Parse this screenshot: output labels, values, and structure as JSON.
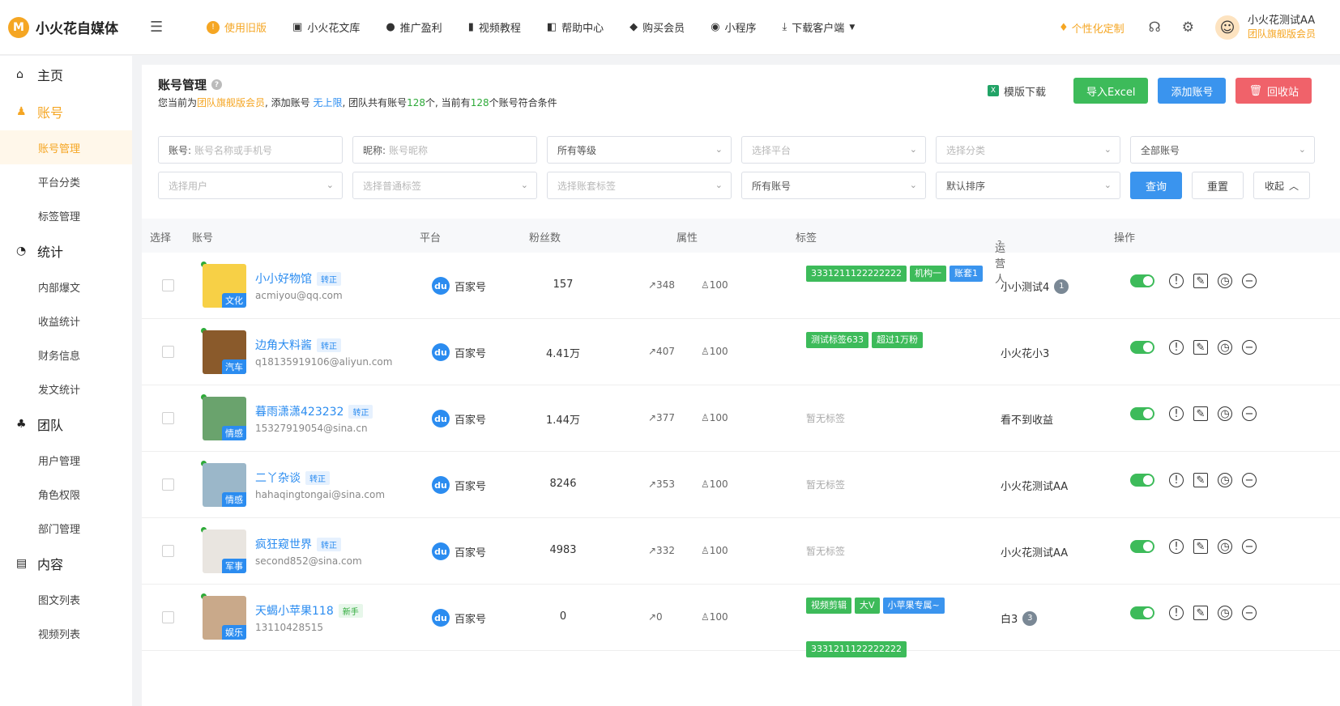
{
  "app": {
    "logo_letter": "M",
    "title": "小火花自媒体"
  },
  "nav": {
    "items": [
      {
        "label": "使用旧版",
        "icon": "info-icon",
        "active": true
      },
      {
        "label": "小火花文库",
        "icon": "library-icon"
      },
      {
        "label": "推广盈利",
        "icon": "moneybag-icon"
      },
      {
        "label": "视频教程",
        "icon": "video-icon"
      },
      {
        "label": "帮助中心",
        "icon": "book-icon"
      },
      {
        "label": "购买会员",
        "icon": "diamond-icon"
      },
      {
        "label": "小程序",
        "icon": "miniprogram-icon"
      },
      {
        "label": "下载客户端",
        "icon": "download-icon"
      }
    ],
    "custom": "个性化定制",
    "user": {
      "name": "小火花测试AA",
      "role": "团队旗舰版会员"
    }
  },
  "sidebar": {
    "groups": [
      {
        "label": "主页",
        "icon": "home-icon"
      },
      {
        "label": "账号",
        "icon": "user-icon",
        "active": true,
        "items": [
          {
            "label": "账号管理",
            "active": true
          },
          {
            "label": "平台分类"
          },
          {
            "label": "标签管理"
          }
        ]
      },
      {
        "label": "统计",
        "icon": "pie-icon",
        "items": [
          {
            "label": "内部爆文"
          },
          {
            "label": "收益统计"
          },
          {
            "label": "财务信息"
          },
          {
            "label": "发文统计"
          }
        ]
      },
      {
        "label": "团队",
        "icon": "team-icon",
        "items": [
          {
            "label": "用户管理"
          },
          {
            "label": "角色权限"
          },
          {
            "label": "部门管理"
          }
        ]
      },
      {
        "label": "内容",
        "icon": "doc-icon",
        "items": [
          {
            "label": "图文列表"
          },
          {
            "label": "视频列表"
          }
        ]
      }
    ]
  },
  "page": {
    "title": "账号管理",
    "sub_prefix": "您当前为",
    "sub_member": "团队旗舰版会员",
    "sub_mid": ", 添加账号 ",
    "sub_unlimited": "无上限",
    "sub_team": ", 团队共有账号",
    "sub_total": "128",
    "sub_unit": "个, 当前有",
    "sub_match": "128",
    "sub_end": "个账号符合条件",
    "template_download": "模版下载",
    "import_excel": "导入Excel",
    "add_account": "添加账号",
    "recycle": "回收站"
  },
  "filters": {
    "account_label": "账号:",
    "account_placeholder": "账号名称或手机号",
    "nickname_label": "昵称:",
    "nickname_placeholder": "账号昵称",
    "level": "所有等级",
    "platform": "选择平台",
    "category": "选择分类",
    "all_accounts": "全部账号",
    "user": "选择用户",
    "common_tag": "选择普通标签",
    "private_tag": "选择账套标签",
    "all_acc2": "所有账号",
    "sort": "默认排序",
    "query": "查询",
    "reset": "重置",
    "collapse": "收起"
  },
  "table": {
    "headers": {
      "select": "选择",
      "account": "账号",
      "platform": "平台",
      "fans": "粉丝数",
      "attr": "属性",
      "tags": "标签",
      "operator": "运营人",
      "ops": "操作"
    },
    "rows": [
      {
        "name": "小小好物馆",
        "badge": "转正",
        "email": "acmiyou@qq.com",
        "cat": "文化",
        "platform": "百家号",
        "fans": "157",
        "a1": "↗348",
        "a2": "♙100",
        "tags": [
          {
            "t": "3331211122222222",
            "c": "g"
          },
          {
            "t": "机构一",
            "c": "g"
          },
          {
            "t": "账套1",
            "c": "b"
          }
        ],
        "operator": "小小测试4",
        "opnum": "1",
        "avbg": "#f7d046"
      },
      {
        "name": "边角大料酱",
        "badge": "转正",
        "email": "q18135919106@aliyun.com",
        "cat": "汽车",
        "platform": "百家号",
        "fans": "4.41万",
        "a1": "↗407",
        "a2": "♙100",
        "tags": [
          {
            "t": "测试标签633",
            "c": "g"
          },
          {
            "t": "超过1万粉",
            "c": "g"
          }
        ],
        "operator": "小火花小3",
        "opnum": "",
        "avbg": "#8a5a2b"
      },
      {
        "name": "暮雨潇潇423232",
        "badge": "转正",
        "email": "15327919054@sina.cn",
        "cat": "情感",
        "platform": "百家号",
        "fans": "1.44万",
        "a1": "↗377",
        "a2": "♙100",
        "tags": [],
        "notag": "暂无标签",
        "operator": "看不到收益",
        "opnum": "",
        "avbg": "#6aa36d"
      },
      {
        "name": "二丫杂谈",
        "badge": "转正",
        "email": "hahaqingtongai@sina.com",
        "cat": "情感",
        "platform": "百家号",
        "fans": "8246",
        "a1": "↗353",
        "a2": "♙100",
        "tags": [],
        "notag": "暂无标签",
        "operator": "小火花测试AA",
        "opnum": "",
        "avbg": "#9bb7c9"
      },
      {
        "name": "疯狂窥世界",
        "badge": "转正",
        "email": "second852@sina.com",
        "cat": "军事",
        "platform": "百家号",
        "fans": "4983",
        "a1": "↗332",
        "a2": "♙100",
        "tags": [],
        "notag": "暂无标签",
        "operator": "小火花测试AA",
        "opnum": "",
        "avbg": "#e9e5e0"
      },
      {
        "name": "天蝎小苹果118",
        "badge": "新手",
        "email": "13110428515",
        "cat": "娱乐",
        "platform": "百家号",
        "fans": "0",
        "a1": "↗0",
        "a2": "♙100",
        "tags": [
          {
            "t": "视频剪辑",
            "c": "g"
          },
          {
            "t": "大V",
            "c": "g"
          },
          {
            "t": "小苹果专属~",
            "c": "b"
          }
        ],
        "operator": "白3",
        "opnum": "3",
        "avbg": "#c9a98a"
      }
    ],
    "partial_tag": "3331211122222222"
  }
}
